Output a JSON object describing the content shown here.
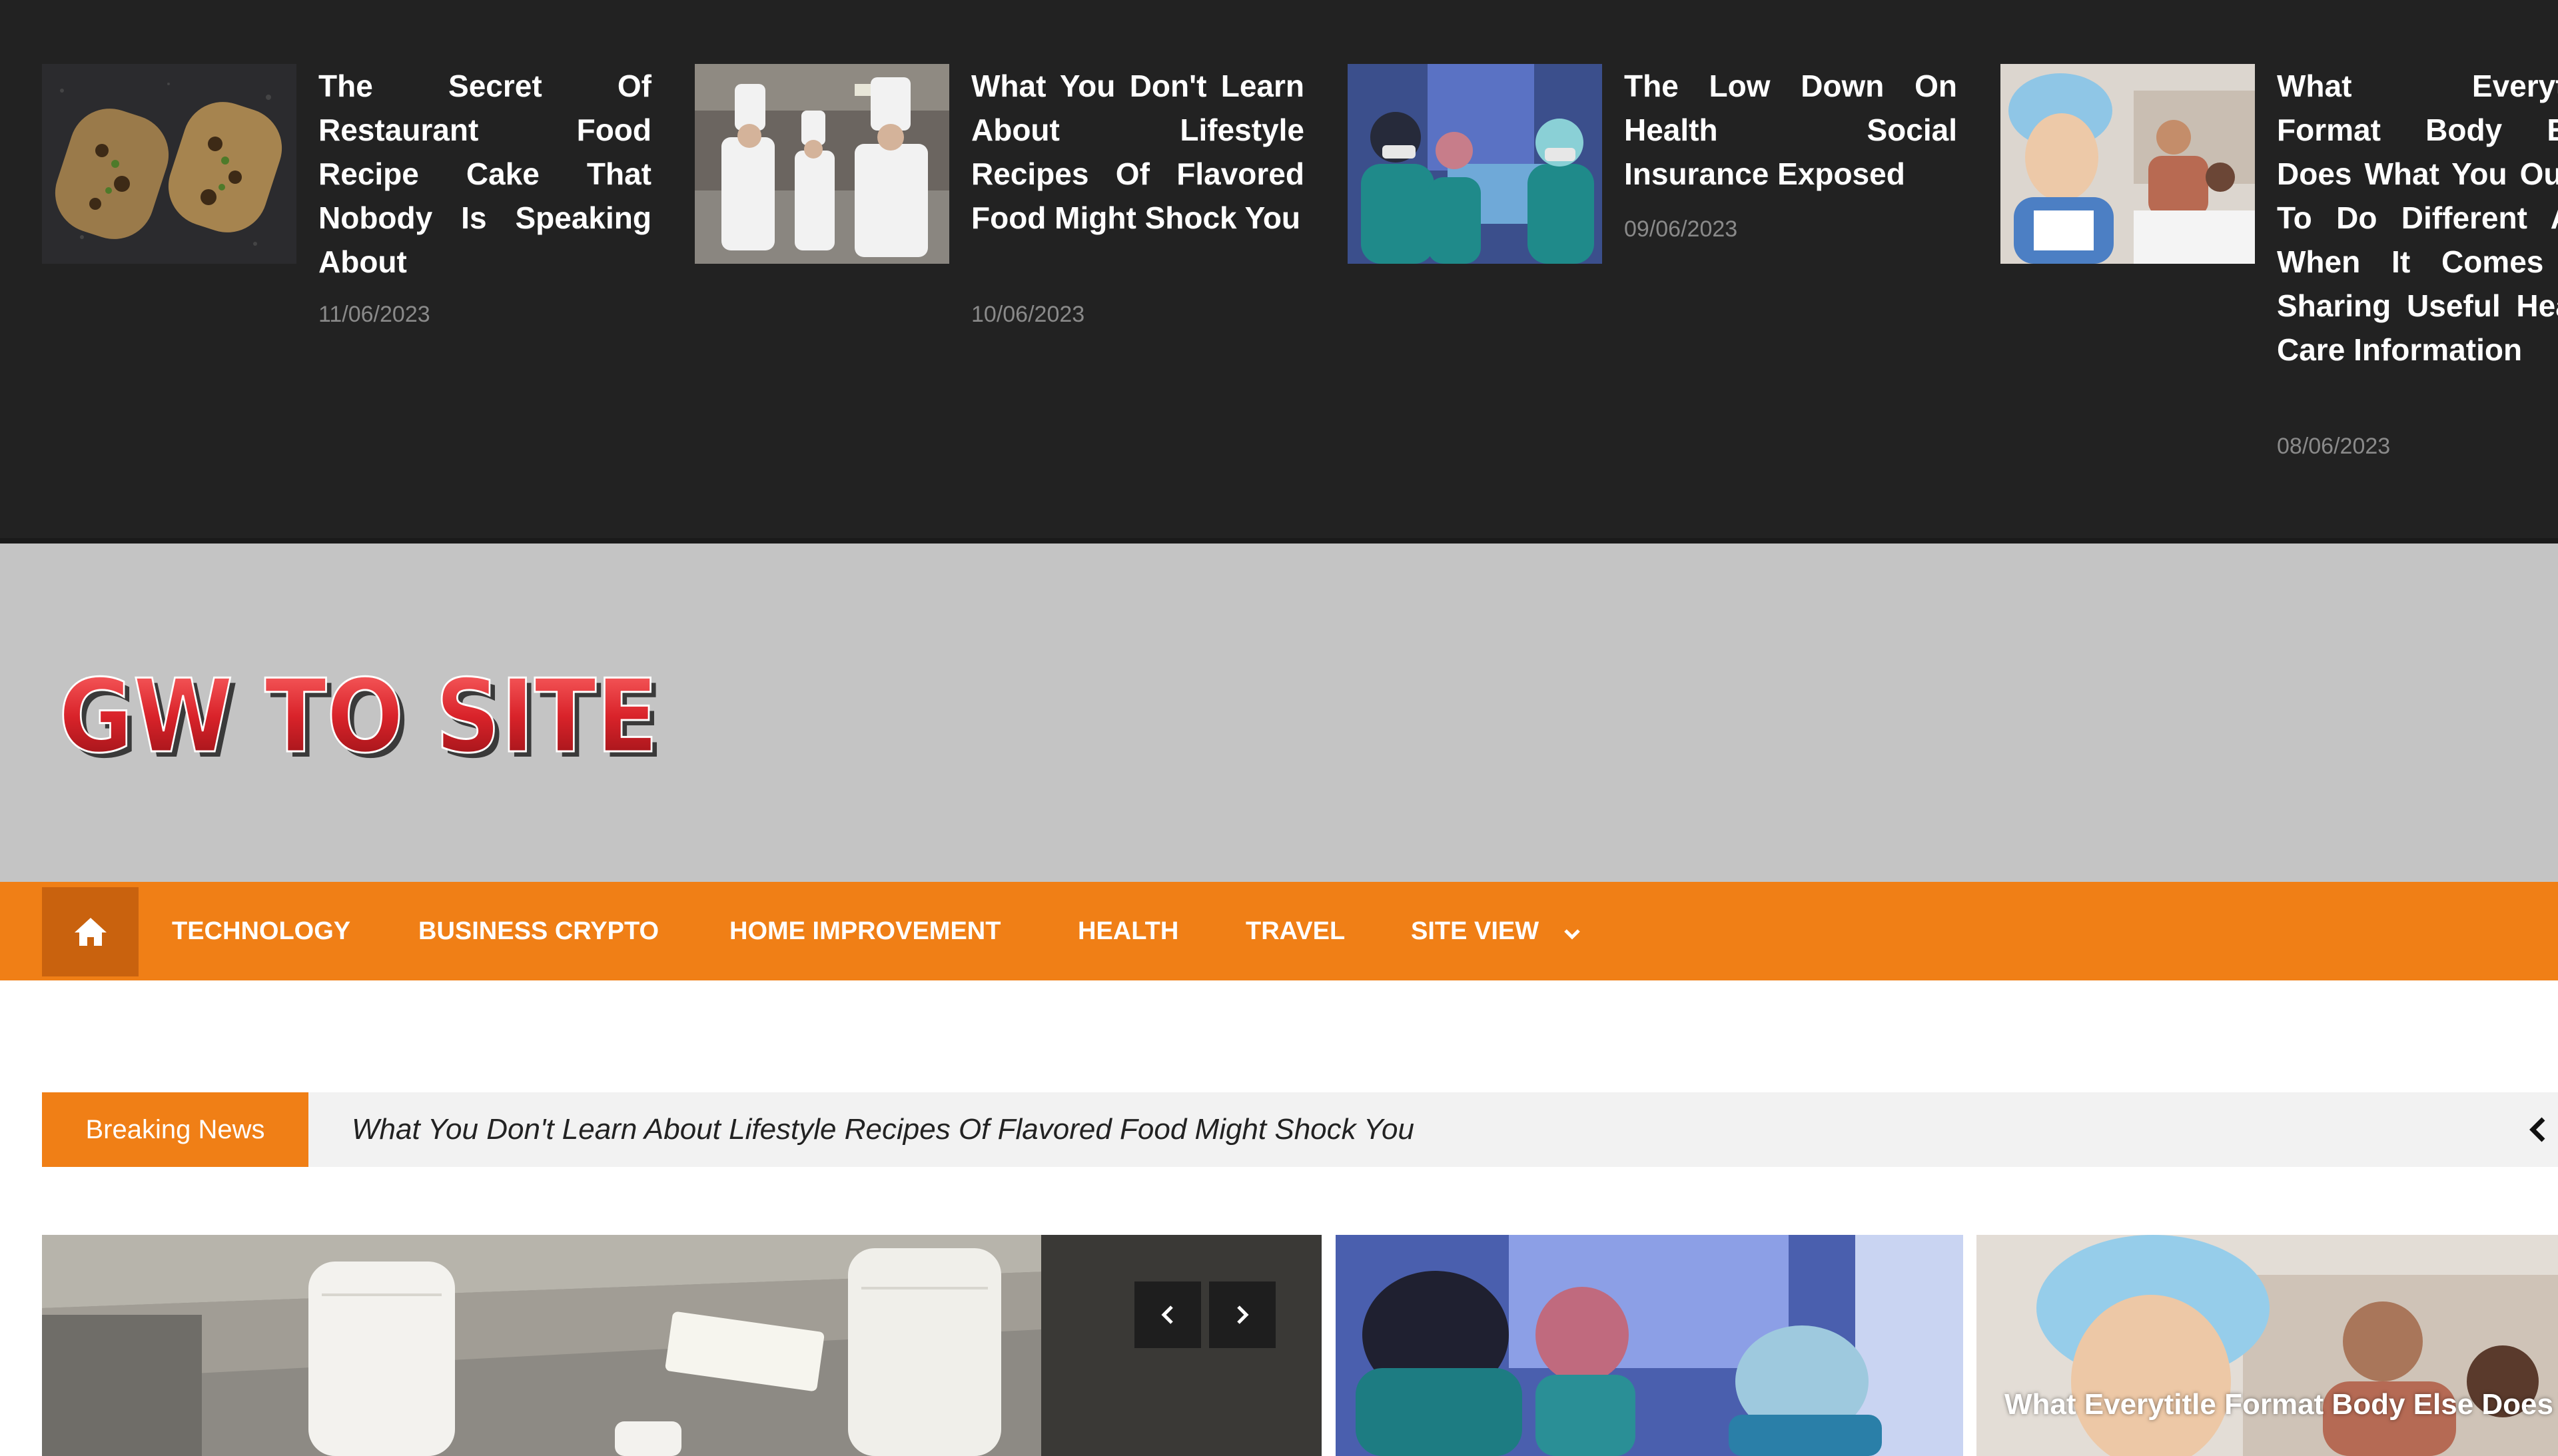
{
  "top_posts": [
    {
      "title": "The Secret Of Restaurant Food Recipe Cake That Nobody Is Speaking About",
      "date": "11/06/2023",
      "image": "food-pastry"
    },
    {
      "title": "What You Don't Learn About Lifestyle Recipes Of Flavored Food Might Shock You",
      "date": "10/06/2023",
      "image": "chefs-kitchen"
    },
    {
      "title": "The Low Down On Health Social Insurance Exposed",
      "date": "09/06/2023",
      "image": "surgery-team"
    },
    {
      "title": "What Everytitle Format Body Else Does What You Ought To Do Different And When It Comes To Sharing Useful Health Care Information",
      "date": "08/06/2023",
      "image": "nurse-patient"
    }
  ],
  "logo": {
    "text": "GW TO SITE",
    "color": "#d9232a"
  },
  "nav": {
    "home_icon": "home-icon",
    "items": [
      "TECHNOLOGY",
      "BUSINESS CRYPTO",
      "HOME IMPROVEMENT",
      "HEALTH",
      "TRAVEL",
      "SITE VIEW"
    ],
    "dropdown_icon": "chevron-down-icon",
    "background": "#f07f16"
  },
  "breaking_news": {
    "label": "Breaking News",
    "headline": "What You Don't Learn About Lifestyle Recipes Of Flavored Food Might Shock You",
    "nav_icon": "chevron-left-icon"
  },
  "featured": {
    "slider_prev_icon": "chevron-left-icon",
    "slider_next_icon": "chevron-right-icon",
    "caption": "What Everytitle Format Body Else Does What You Ought To Do Different"
  },
  "colors": {
    "accent": "#f07f16",
    "dark": "#222222",
    "header": "#c4c4c4"
  }
}
